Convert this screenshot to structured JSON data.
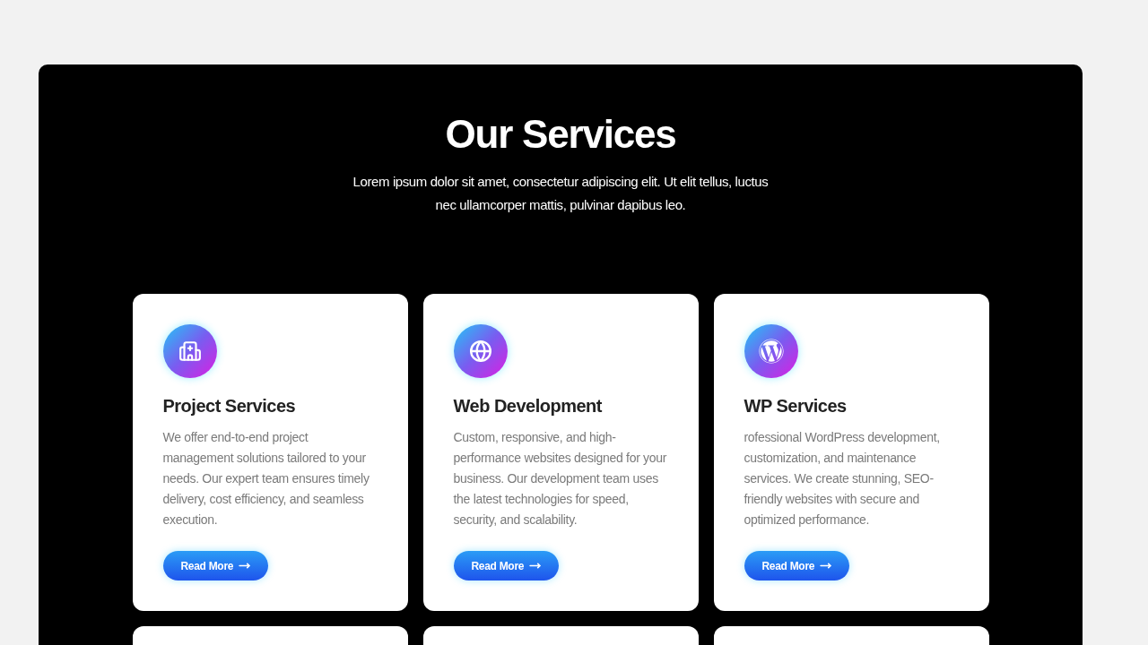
{
  "section": {
    "title": "Our Services",
    "subtitle": "Lorem ipsum dolor sit amet, consectetur adipiscing elit. Ut elit tellus, luctus nec ullamcorper mattis, pulvinar dapibus leo."
  },
  "services": [
    {
      "kind": "card",
      "title": "Project Services",
      "text": "We offer end-to-end project management solutions tailored to your needs. Our expert team ensures timely delivery, cost efficiency, and seamless execution.",
      "button": "Read More"
    },
    {
      "kind": "card",
      "title": "Web Development",
      "text": "Custom, responsive, and high-performance websites designed for your business. Our development team uses the latest technologies for speed, security, and scalability.",
      "button": "Read More"
    },
    {
      "kind": "card",
      "title": "WP Services",
      "text": "rofessional WordPress development, customization, and maintenance services. We create stunning, SEO-friendly websites with secure and optimized performance.",
      "button": "Read More"
    },
    {
      "kind": "clipped"
    },
    {
      "kind": "clipped"
    },
    {
      "kind": "clipped"
    }
  ]
}
